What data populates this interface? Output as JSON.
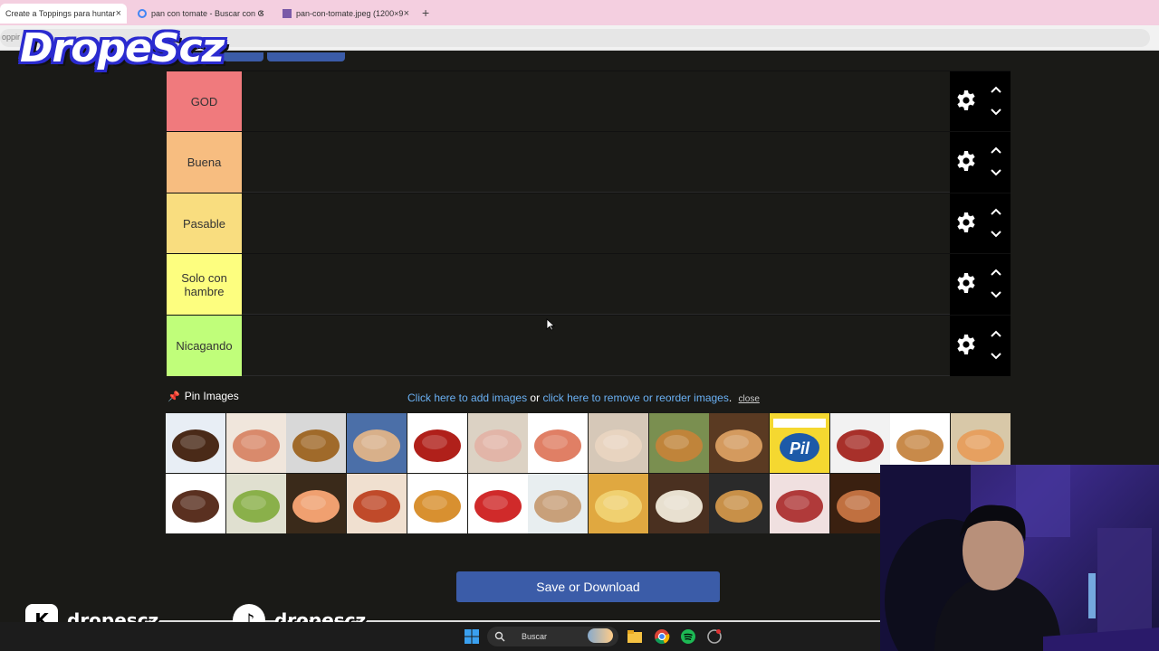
{
  "browser": {
    "tabs": [
      {
        "title": "Create a Toppings para huntar",
        "active": true
      },
      {
        "title": "pan con tomate - Buscar con G",
        "active": false
      },
      {
        "title": "pan-con-tomate.jpeg (1200×9",
        "active": false
      }
    ],
    "new_tab": "+",
    "close_glyph": "×",
    "address_partial": "oppir"
  },
  "watermark": "DropeScz",
  "tiers": [
    {
      "label": "GOD",
      "color": "#f07a7d"
    },
    {
      "label": "Buena",
      "color": "#f7bd80"
    },
    {
      "label": "Pasable",
      "color": "#f9dd7f"
    },
    {
      "label": "Solo con hambre",
      "color": "#fdfe7f"
    },
    {
      "label": "Nicagando",
      "color": "#c0fe7a"
    }
  ],
  "pin": {
    "label": "Pin Images",
    "icon": "pushpin-icon"
  },
  "instructions": {
    "add_link": "Click here to add images",
    "or_text": "or",
    "remove_link": "click here to remove or reorder images",
    "period": ".",
    "close": "close"
  },
  "images": [
    {
      "name": "meat-patties-image",
      "colors": [
        "#e8eef5",
        "#4a2a18"
      ]
    },
    {
      "name": "tomato-toast-image",
      "colors": [
        "#f0e6dc",
        "#d98a6c"
      ]
    },
    {
      "name": "burger-image",
      "colors": [
        "#d8d8d8",
        "#a06a2a"
      ]
    },
    {
      "name": "chicken-sandwich-image",
      "colors": [
        "#4b6fa8",
        "#d8b08a"
      ]
    },
    {
      "name": "dulce-de-leche-cup-image",
      "colors": [
        "#ffffff",
        "#b0201a"
      ]
    },
    {
      "name": "ham-sandwich-image",
      "colors": [
        "#dcd2c4",
        "#e2b5a8"
      ]
    },
    {
      "name": "ketchup-toast-image",
      "colors": [
        "#ffffff",
        "#e07f65"
      ]
    },
    {
      "name": "cream-cheese-bread-image",
      "colors": [
        "#d6c8b8",
        "#e8d4c0"
      ]
    },
    {
      "name": "jam-jar-image",
      "colors": [
        "#7a8f50",
        "#c0843a"
      ]
    },
    {
      "name": "peanut-butter-toast-image",
      "colors": [
        "#5a3a22",
        "#d49a5e"
      ]
    },
    {
      "name": "mantequilla-pil-image",
      "colors": [
        "#f5d830",
        "#1d5aa8"
      ]
    },
    {
      "name": "jam-toast-image",
      "colors": [
        "#f2f2f2",
        "#a8302a"
      ]
    },
    {
      "name": "toasted-sandwich-image",
      "colors": [
        "#ffffff",
        "#c88a4a"
      ]
    },
    {
      "name": "sub-sandwich-image",
      "colors": [
        "#d8c8a8",
        "#e6a060"
      ]
    },
    {
      "name": "nutella-bread-image",
      "colors": [
        "#ffffff",
        "#5a3020"
      ]
    },
    {
      "name": "avocado-toast-image",
      "colors": [
        "#e0e0d0",
        "#8ab04a"
      ]
    },
    {
      "name": "salmon-bagel-image",
      "colors": [
        "#3a2a1a",
        "#f0a070"
      ]
    },
    {
      "name": "hot-dog-image",
      "colors": [
        "#f0e0d0",
        "#c04a2a"
      ]
    },
    {
      "name": "fries-burger-image",
      "colors": [
        "#ffffff",
        "#d89030"
      ]
    },
    {
      "name": "tuna-can-image",
      "colors": [
        "#ffffff",
        "#d02a2a"
      ]
    },
    {
      "name": "chicken-salad-bun-image",
      "colors": [
        "#e8eef0",
        "#c8a07a"
      ]
    },
    {
      "name": "grilled-cheese-image",
      "colors": [
        "#e0a840",
        "#f0d070"
      ]
    },
    {
      "name": "butter-bread-image",
      "colors": [
        "#4a3020",
        "#e8e0d0"
      ]
    },
    {
      "name": "toast-scramble-image",
      "colors": [
        "#2a2a2a",
        "#c89048"
      ]
    },
    {
      "name": "bacon-image",
      "colors": [
        "#f0e0e0",
        "#b03a3a"
      ]
    },
    {
      "name": "pulled-pork-bun-image",
      "colors": [
        "#3a2010",
        "#c07040"
      ]
    }
  ],
  "save_button": "Save or Download",
  "socials": [
    {
      "icon": "kick-icon",
      "handle": "dropescz"
    },
    {
      "icon": "tiktok-icon",
      "handle": "dropescz"
    }
  ],
  "taskbar": {
    "search_label": "Buscar"
  }
}
